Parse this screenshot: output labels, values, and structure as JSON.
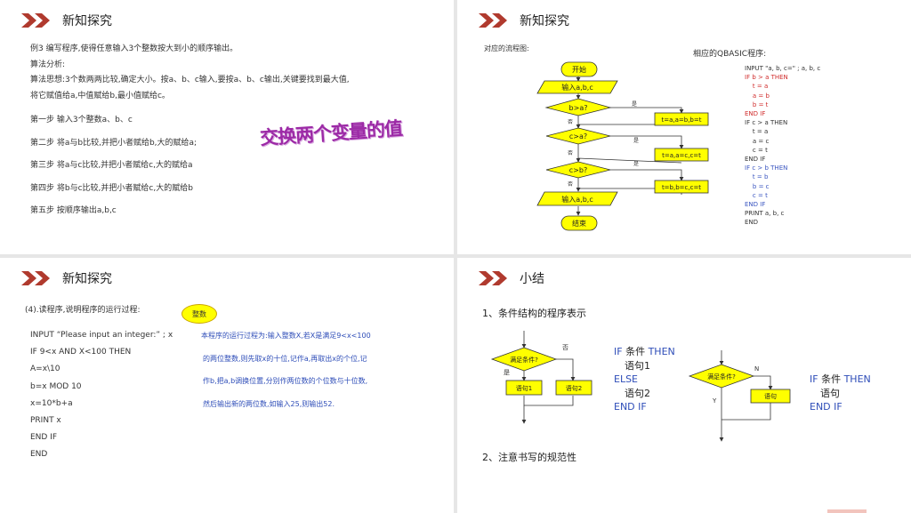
{
  "slides": {
    "s1": {
      "title": "新知探究",
      "example": "例3 编写程序,使得任意输入3个整数按大到小的顺序输出。",
      "analysis_head": "算法分析:",
      "idea_line1": "算法思想:3个数两两比较,确定大小。按a、b、c输入,要按a、b、c输出,关键要找到最大值,",
      "idea_line2": "将它赋值给a,中值赋给b,最小值赋给c。",
      "steps": [
        "第一步 输入3个整数a、b、c",
        "第二步 将a与b比较,并把小者赋给b,大的赋给a;",
        "第三步 将a与c比较,并把小者赋给c,大的赋给a",
        "第四步 将b与c比较,并把小者赋给c,大的赋给b",
        "第五步 按顺序输出a,b,c"
      ],
      "wordart": "交换两个变量的值"
    },
    "s2": {
      "title": "新知探究",
      "flow_label": "对应的流程图:",
      "qbasic_label": "相应的QBASIC程序:",
      "flow": {
        "start": "开始",
        "input": "输入a,b,c",
        "cond1": "b>a?",
        "cond2": "c>a?",
        "cond3": "c>b?",
        "act1": "t=a,a=b,b=t",
        "act2": "t=a,a=c,c=t",
        "act3": "t=b,b=c,c=t",
        "output": "输入a,b,c",
        "end": "结束",
        "yes": "是",
        "no": "否"
      },
      "code": [
        {
          "text": "INPUT \"a, b, c=\" ; a, b, c",
          "color": "#333333"
        },
        {
          "text": "IF b > a THEN",
          "color": "#d02c2c"
        },
        {
          "text": "    t = a",
          "color": "#d02c2c"
        },
        {
          "text": "    a = b",
          "color": "#d02c2c"
        },
        {
          "text": "    b = t",
          "color": "#d02c2c"
        },
        {
          "text": "END IF",
          "color": "#d02c2c"
        },
        {
          "text": "IF c > a THEN",
          "color": "#333333"
        },
        {
          "text": "    t = a",
          "color": "#333333"
        },
        {
          "text": "    a = c",
          "color": "#333333"
        },
        {
          "text": "    c = t",
          "color": "#333333"
        },
        {
          "text": "END IF",
          "color": "#333333"
        },
        {
          "text": "IF c > b THEN",
          "color": "#3a55c0"
        },
        {
          "text": "    t = b",
          "color": "#3a55c0"
        },
        {
          "text": "    b = c",
          "color": "#3a55c0"
        },
        {
          "text": "    c = t",
          "color": "#3a55c0"
        },
        {
          "text": "END IF",
          "color": "#3a55c0"
        },
        {
          "text": "PRINT a, b, c",
          "color": "#333333"
        },
        {
          "text": "END",
          "color": "#333333"
        }
      ]
    },
    "s3": {
      "title": "新知探究",
      "question": "(4).读程序,说明程序的运行过程:",
      "badge": "整数",
      "program": [
        "INPUT “Please input an integer:” ; x",
        "IF 9<x AND X<100 THEN",
        "    A=x\\10",
        "    b=x MOD 10",
        "    x=10*b+a",
        "    PRINT x",
        "END IF",
        "END"
      ],
      "explain": [
        "本程序的运行过程为:输入整数X,若X是满足9<x<100",
        "的两位整数,则先取x的十位,记作a,再取出x的个位,记",
        "作b,把a,b调换位置,分别作两位数的个位数与十位数,",
        "然后输出新的两位数,如输入25,则输出52."
      ]
    },
    "s4": {
      "title": "小结",
      "point1": "1、条件结构的程序表示",
      "point2": "2、注意书写的规范性",
      "flowA": {
        "cond": "满足条件?",
        "yes": "是",
        "no": "否",
        "stmt1": "语句1",
        "stmt2": "语句2"
      },
      "codeA": {
        "l1_kw1": "IF",
        "l1_txt": "条件",
        "l1_kw2": "THEN",
        "l2": "语句1",
        "l3": "ELSE",
        "l4": "语句2",
        "l5": "END IF"
      },
      "flowB": {
        "cond": "满足条件?",
        "yes": "Y",
        "no": "N",
        "stmt": "语句"
      },
      "codeB": {
        "l1_kw1": "IF",
        "l1_txt": "条件",
        "l1_kw2": "THEN",
        "l2": "语句",
        "l3": "END IF"
      }
    }
  },
  "colors": {
    "accent": "#b03a2e",
    "flow_fill": "#ffff00",
    "flow_stroke": "#333333",
    "blue": "#2e4db8",
    "wordart": "#9c2aa6"
  }
}
